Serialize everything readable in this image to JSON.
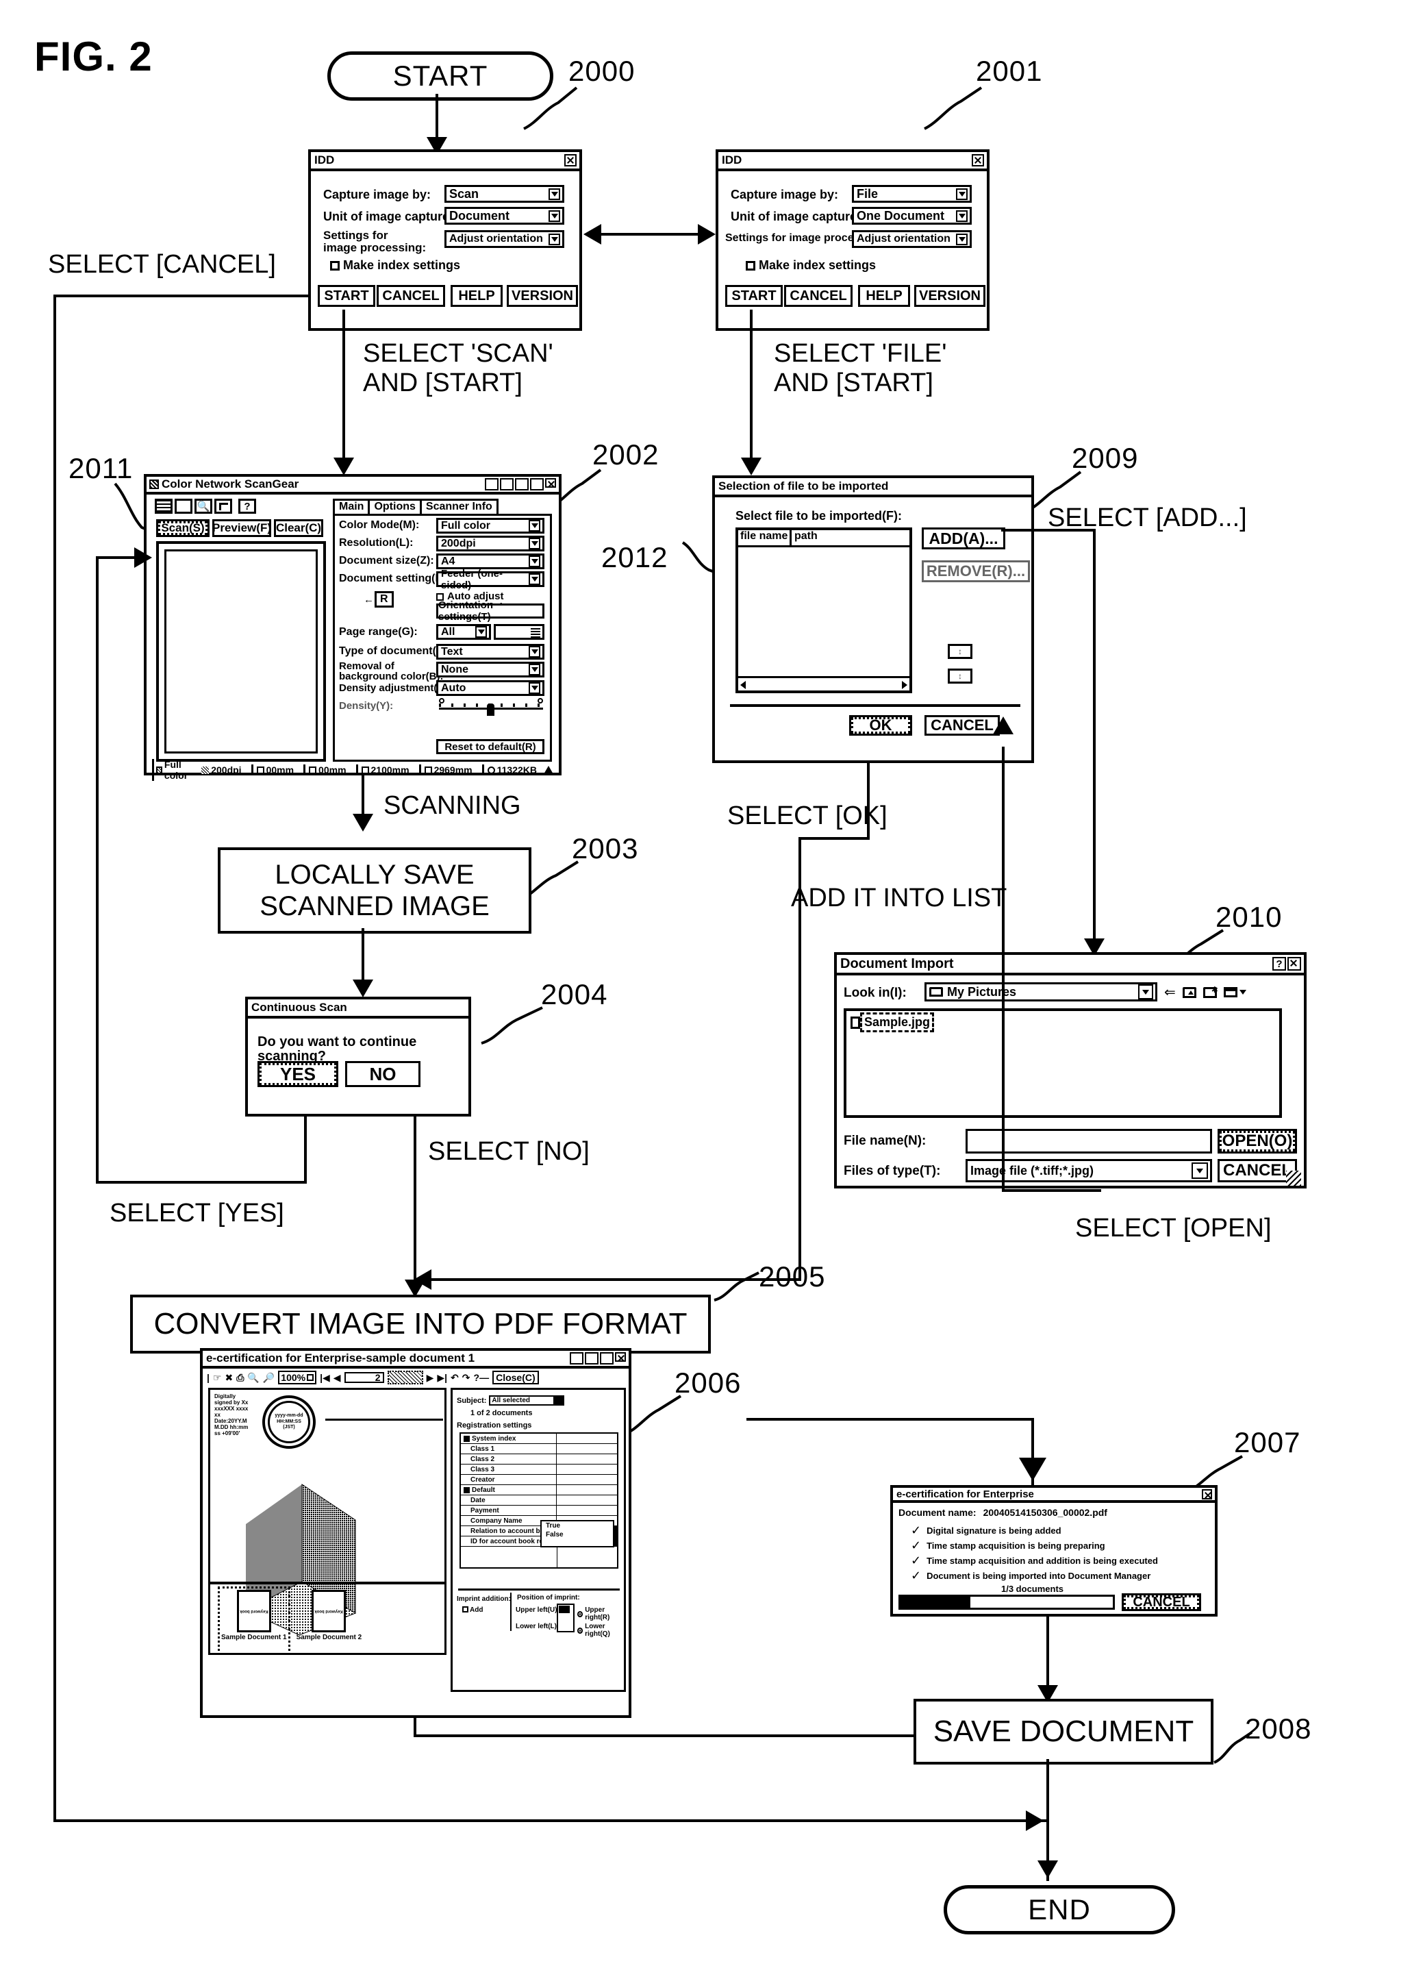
{
  "figure": {
    "label": "FIG. 2"
  },
  "flow": {
    "start": "START",
    "end": "END",
    "steps": {
      "save_scanned": "LOCALLY SAVE\nSCANNED IMAGE",
      "convert_pdf": "CONVERT IMAGE INTO PDF FORMAT",
      "save_document": "SAVE DOCUMENT"
    },
    "labels": {
      "select_cancel": "SELECT [CANCEL]",
      "select_scan_start": "SELECT 'SCAN'\nAND [START]",
      "select_file_start": "SELECT 'FILE'\nAND [START]",
      "select_add": "SELECT [ADD...]",
      "scanning": "SCANNING",
      "select_ok": "SELECT [OK]",
      "add_into_list": "ADD IT INTO LIST",
      "select_yes": "SELECT [YES]",
      "select_no": "SELECT [NO]",
      "select_open": "SELECT [OPEN]"
    },
    "refs": {
      "r2000": "2000",
      "r2001": "2001",
      "r2002": "2002",
      "r2003": "2003",
      "r2004": "2004",
      "r2005": "2005",
      "r2006": "2006",
      "r2007": "2007",
      "r2008": "2008",
      "r2009": "2009",
      "r2010": "2010",
      "r2011": "2011",
      "r2012": "2012"
    }
  },
  "idd_scan": {
    "title": "IDD",
    "rows": [
      {
        "label": "Capture image by:",
        "value": "Scan"
      },
      {
        "label": "Unit of image capture:",
        "value": "Document"
      },
      {
        "label": "Settings for\nimage processing:",
        "value": "Adjust orientation"
      }
    ],
    "checkbox": "Make index settings",
    "buttons": [
      "START",
      "CANCEL",
      "HELP",
      "VERSION"
    ]
  },
  "idd_file": {
    "title": "IDD",
    "rows": [
      {
        "label": "Capture image by:",
        "value": "File"
      },
      {
        "label": "Unit of image capture:",
        "value": "One Document"
      },
      {
        "label": "Settings for image processing:",
        "value": "Adjust orientation"
      }
    ],
    "checkbox": "Make index settings",
    "buttons": [
      "START",
      "CANCEL",
      "HELP",
      "VERSION"
    ]
  },
  "scangear": {
    "title": "Color Network ScanGear",
    "toolbar_icons": [
      "marquee-icon",
      "blank-icon",
      "zoom-icon",
      "crop-icon",
      "help-icon"
    ],
    "action_buttons": [
      "Scan(S)",
      "Preview(F)",
      "Clear(C)"
    ],
    "tabs": [
      "Main",
      "Options",
      "Scanner Info"
    ],
    "fields": [
      {
        "label": "Color Mode(M):",
        "value": "Full color"
      },
      {
        "label": "Resolution(L):",
        "value": "200dpi"
      },
      {
        "label": "Document size(Z):",
        "value": "A4"
      },
      {
        "label": "Document setting(I):",
        "value": "Feeder (one-sided)"
      }
    ],
    "orientation_check": "Auto adjust orientation(U)",
    "orientation_button": "Orientation settings(T)",
    "rotate_marker": "R",
    "page_range_label": "Page range(G):",
    "page_range_value": "All",
    "fields2": [
      {
        "label": "Type of document(O):",
        "value": "Text"
      },
      {
        "label": "Removal of\nbackground color(B):",
        "value": "None"
      },
      {
        "label": "Density adjustment(D):",
        "value": "Auto"
      }
    ],
    "density_label": "Density(Y):",
    "reset_button": "Reset to default(R)",
    "status": [
      "Full color",
      "200dpi",
      "00mm",
      "00mm",
      "2100mm",
      "2969mm",
      "11322KB"
    ]
  },
  "selection_dialog": {
    "title": "Selection of file to be imported",
    "list_label": "Select file to be imported(F):",
    "columns": [
      "file name",
      "path"
    ],
    "rows": [],
    "buttons": {
      "add": "ADD(A)...",
      "remove": "REMOVE(R)...",
      "ok": "OK",
      "cancel": "CANCEL"
    }
  },
  "document_import": {
    "title": "Document Import",
    "look_in_label": "Look in(I):",
    "look_in_value": "My Pictures",
    "files": [
      "Sample.jpg"
    ],
    "file_name_label": "File name(N):",
    "file_name_value": "",
    "files_of_type_label": "Files of type(T):",
    "files_of_type_value": "Image file (*.tiff;*.jpg)",
    "buttons": {
      "open": "OPEN(O)",
      "cancel": "CANCEL"
    },
    "toolbar_icons": [
      "back-icon",
      "up-folder-icon",
      "new-folder-icon",
      "view-menu-icon"
    ]
  },
  "continuous_scan": {
    "title": "Continuous Scan",
    "message": "Do you want to continue scanning?",
    "buttons": [
      "YES",
      "NO"
    ]
  },
  "ecert_main": {
    "title": "e-certification for Enterprise-sample document 1",
    "toolbar": {
      "zoom_value": "100%",
      "page_value": "2",
      "close_button": "Close(C)"
    },
    "stamp_text": "Digitally\nsigned by Xx\nxxxXXX xxxx\nxx\nDate:20YY.M\nM.DD hh:mm\nss +09'00'",
    "seal_text": "yyyy-mm-dd\nHH:MM:SS\n(JST)",
    "subject_label": "Subject:",
    "subject_value": "All selected",
    "doc_count": "1 of 2 documents",
    "reg_label": "Registration settings",
    "reg_rows": [
      "System index",
      "Class 1",
      "Class 2",
      "Class 3",
      "Creator",
      "Default",
      "Date",
      "Payment",
      "Company Name",
      "Relation to account book",
      "ID for account book relation"
    ],
    "dropdown_options": [
      "True",
      "False"
    ],
    "imprint_label": "Imprint addition:",
    "imprint_checkbox": "Add",
    "position_label": "Position of imprint:",
    "positions": [
      "Upper left(U)",
      "Upper right(R)",
      "Lower left(L)",
      "Lower right(Q)"
    ],
    "thumbnails": [
      "Sample Document 1",
      "Sample Document 2"
    ],
    "thumb_inner_text": "Keyword book"
  },
  "ecert_progress": {
    "title": "e-certification for Enterprise",
    "doc_name_label": "Document name:",
    "doc_name_value": "20040514150306_00002.pdf",
    "steps": [
      "Digital signature is being added",
      "Time stamp acquisition is being preparing",
      "Time stamp acquisition and addition is being executed",
      "Document is being imported into Document Manager"
    ],
    "progress_text": "1/3   documents",
    "progress_percent": 33,
    "cancel_button": "CANCEL"
  }
}
